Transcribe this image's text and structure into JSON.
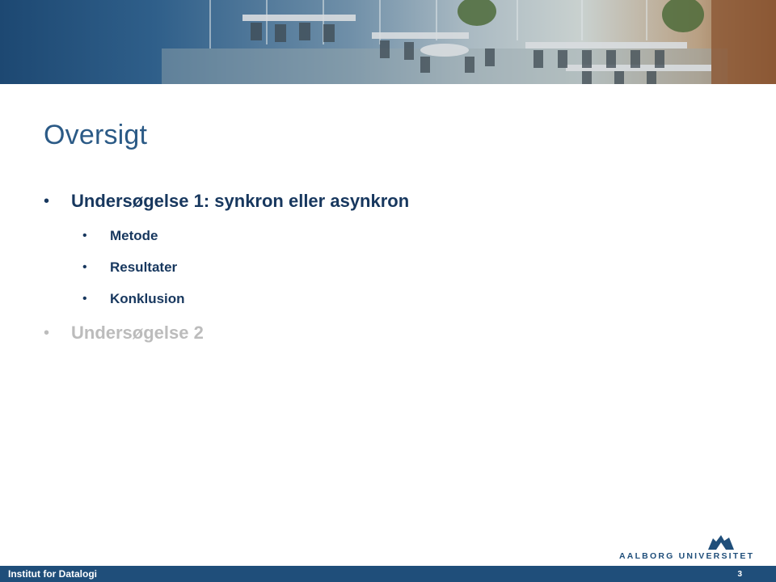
{
  "slide": {
    "title": "Oversigt",
    "bullets": [
      {
        "text": "Undersøgelse 1: synkron eller asynkron",
        "children": [
          "Metode",
          "Resultater",
          "Konklusion"
        ]
      },
      {
        "text": "Undersøgelse 2",
        "children": [],
        "dimmed": true
      }
    ],
    "bullet_glyph": "•"
  },
  "logo": {
    "text": "AALBORG UNIVERSITET"
  },
  "footer": {
    "institute": "Institut for Datalogi",
    "page_number": "3"
  },
  "colors": {
    "title": "#2b5a86",
    "text": "#17375e",
    "dimmed": "#bcbcbc",
    "footer_bar": "#1f4e7a"
  }
}
